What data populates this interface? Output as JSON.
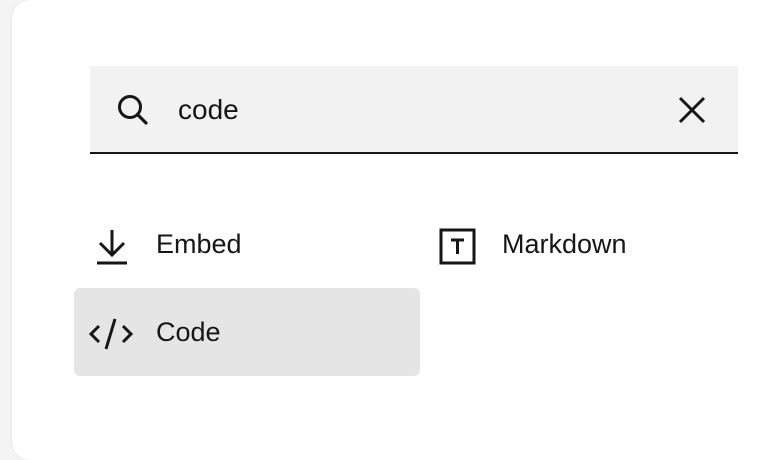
{
  "search": {
    "value": "code",
    "icon": "search-icon",
    "clear_icon": "close-icon"
  },
  "results": [
    {
      "label": "Embed",
      "icon": "download-icon",
      "selected": false
    },
    {
      "label": "Markdown",
      "icon": "text-box-icon",
      "selected": false
    },
    {
      "label": "Code",
      "icon": "code-icon",
      "selected": true
    }
  ],
  "colors": {
    "text": "#161616",
    "search_bg": "#f2f2f2",
    "selected_bg": "#e5e5e5",
    "panel_bg": "#ffffff"
  }
}
